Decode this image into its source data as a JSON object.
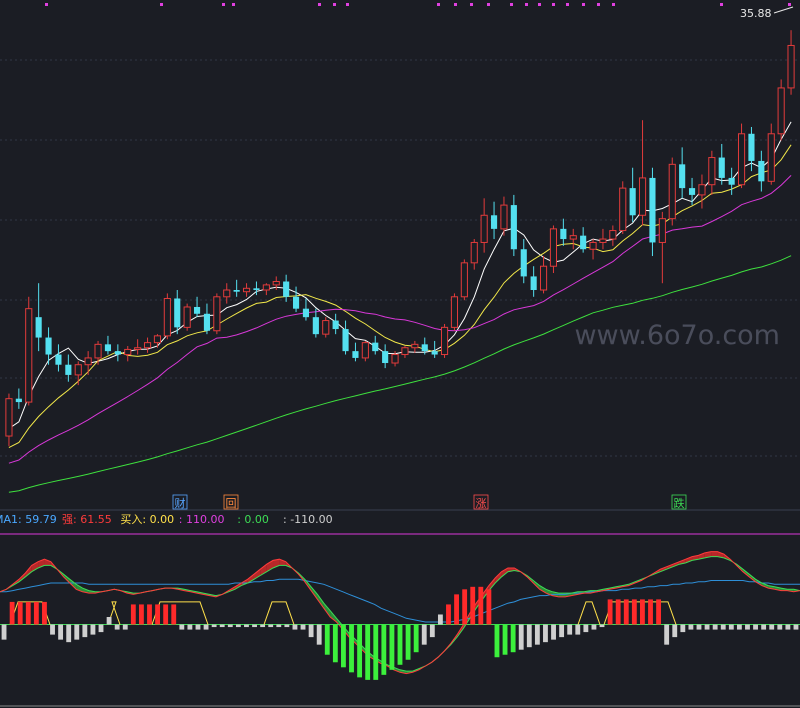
{
  "watermark": "www.6o7o.com",
  "price_top_label": "35.88",
  "markers": [
    {
      "text": "财",
      "color": "#58a6ff"
    },
    {
      "text": "回",
      "color": "#ff8a3d"
    },
    {
      "text": "涨",
      "color": "#ff4d4d"
    },
    {
      "text": "跌",
      "color": "#3ddc55"
    }
  ],
  "indicator_readout": [
    {
      "text": "MA1: 59.79",
      "color": "#4aa8ff"
    },
    {
      "text": "强: 61.55",
      "color": "#ff3b3b"
    },
    {
      "text": "买入: 0.00",
      "color": "#ffe04a"
    },
    {
      "text": ": 110.00",
      "color": "#e040e0"
    },
    {
      "text": ": 0.00",
      "color": "#3ddc55"
    },
    {
      "text": ": -110.00",
      "color": "#cfcfcf"
    }
  ],
  "colors": {
    "background": "#1b1d24",
    "up": "#e23b3b",
    "down": "#54e0f0",
    "ma_fast": "#ffffff",
    "ma_mid": "#f2e84a",
    "ma_slow": "#d838d8",
    "ma_long": "#3ee03e",
    "grid": "#323646"
  },
  "chart_data": [
    {
      "type": "candlestick",
      "ylim": [
        10,
        36.5
      ],
      "candles": [
        [
          12.0,
          14.5,
          11.4,
          14.2
        ],
        [
          14.2,
          14.8,
          13.6,
          14.0
        ],
        [
          14.0,
          20.2,
          13.8,
          19.5
        ],
        [
          19.0,
          21.0,
          17.0,
          17.8
        ],
        [
          17.8,
          18.4,
          16.2,
          16.8
        ],
        [
          16.8,
          17.4,
          15.8,
          16.2
        ],
        [
          16.2,
          16.8,
          15.2,
          15.6
        ],
        [
          15.6,
          16.4,
          15.0,
          16.2
        ],
        [
          16.2,
          17.0,
          15.6,
          16.6
        ],
        [
          16.6,
          17.6,
          16.2,
          17.4
        ],
        [
          17.4,
          17.9,
          16.8,
          17.0
        ],
        [
          17.0,
          17.4,
          16.4,
          16.8
        ],
        [
          16.8,
          17.3,
          16.4,
          17.1
        ],
        [
          17.1,
          17.7,
          16.8,
          17.2
        ],
        [
          17.2,
          17.8,
          16.9,
          17.5
        ],
        [
          17.5,
          18.0,
          17.2,
          17.9
        ],
        [
          17.9,
          20.4,
          17.7,
          20.1
        ],
        [
          20.1,
          20.6,
          18.0,
          18.4
        ],
        [
          18.4,
          19.8,
          18.2,
          19.6
        ],
        [
          19.6,
          20.2,
          19.0,
          19.2
        ],
        [
          19.2,
          19.8,
          18.0,
          18.2
        ],
        [
          18.2,
          20.4,
          18.0,
          20.2
        ],
        [
          20.2,
          21.0,
          19.8,
          20.6
        ],
        [
          20.6,
          21.2,
          20.2,
          20.5
        ],
        [
          20.5,
          21.0,
          20.2,
          20.7
        ],
        [
          20.7,
          21.1,
          20.3,
          20.6
        ],
        [
          20.6,
          21.0,
          20.3,
          20.9
        ],
        [
          20.9,
          21.4,
          20.6,
          21.1
        ],
        [
          21.1,
          21.5,
          19.9,
          20.2
        ],
        [
          20.2,
          20.8,
          19.3,
          19.5
        ],
        [
          19.5,
          20.1,
          18.8,
          19.0
        ],
        [
          19.0,
          19.5,
          17.8,
          18.0
        ],
        [
          18.0,
          19.0,
          17.8,
          18.8
        ],
        [
          18.8,
          19.2,
          18.0,
          18.3
        ],
        [
          18.3,
          18.8,
          16.8,
          17.0
        ],
        [
          17.0,
          17.5,
          16.4,
          16.6
        ],
        [
          16.6,
          17.6,
          16.4,
          17.5
        ],
        [
          17.5,
          17.9,
          16.8,
          17.0
        ],
        [
          17.0,
          17.4,
          16.0,
          16.3
        ],
        [
          16.3,
          17.0,
          16.1,
          16.8
        ],
        [
          16.8,
          17.3,
          16.6,
          17.2
        ],
        [
          17.2,
          17.6,
          16.9,
          17.4
        ],
        [
          17.4,
          17.8,
          16.8,
          17.0
        ],
        [
          17.0,
          17.6,
          16.6,
          16.8
        ],
        [
          16.8,
          18.6,
          16.6,
          18.4
        ],
        [
          18.4,
          20.4,
          18.2,
          20.2
        ],
        [
          20.2,
          22.4,
          20.0,
          22.2
        ],
        [
          22.2,
          23.6,
          21.8,
          23.4
        ],
        [
          23.4,
          26.0,
          22.8,
          25.0
        ],
        [
          25.0,
          25.8,
          23.6,
          24.2
        ],
        [
          24.2,
          26.1,
          23.8,
          25.6
        ],
        [
          25.6,
          26.2,
          22.6,
          23.0
        ],
        [
          23.0,
          23.6,
          21.0,
          21.4
        ],
        [
          21.4,
          22.0,
          20.2,
          20.6
        ],
        [
          20.6,
          22.6,
          20.4,
          22.0
        ],
        [
          22.0,
          24.4,
          21.6,
          24.2
        ],
        [
          24.2,
          24.8,
          23.2,
          23.6
        ],
        [
          23.6,
          24.2,
          23.0,
          23.8
        ],
        [
          23.8,
          24.3,
          22.8,
          23.0
        ],
        [
          23.0,
          23.6,
          22.4,
          23.4
        ],
        [
          23.4,
          24.2,
          23.0,
          23.6
        ],
        [
          23.6,
          24.4,
          23.2,
          24.1
        ],
        [
          24.1,
          27.0,
          23.9,
          26.6
        ],
        [
          26.6,
          27.8,
          24.6,
          25.0
        ],
        [
          25.0,
          30.6,
          24.4,
          27.2
        ],
        [
          27.2,
          27.8,
          22.6,
          23.4
        ],
        [
          23.4,
          25.2,
          21.0,
          24.8
        ],
        [
          24.8,
          28.4,
          24.4,
          28.0
        ],
        [
          28.0,
          29.0,
          26.0,
          26.6
        ],
        [
          26.6,
          27.2,
          25.6,
          26.2
        ],
        [
          26.2,
          27.4,
          25.4,
          26.8
        ],
        [
          26.8,
          28.8,
          26.2,
          28.4
        ],
        [
          28.4,
          29.2,
          26.8,
          27.2
        ],
        [
          27.2,
          27.8,
          26.2,
          26.8
        ],
        [
          26.8,
          30.4,
          26.6,
          29.8
        ],
        [
          29.8,
          30.2,
          27.6,
          28.2
        ],
        [
          28.2,
          28.8,
          26.4,
          27.0
        ],
        [
          27.0,
          30.4,
          26.8,
          29.8
        ],
        [
          29.8,
          33.0,
          29.4,
          32.5
        ],
        [
          32.5,
          35.9,
          32.1,
          35.0
        ]
      ],
      "ma_periods": [
        5,
        10,
        20,
        60
      ]
    },
    {
      "type": "line+bar",
      "series": [
        {
          "values": [
            26,
            28,
            32,
            36,
            41,
            47,
            50,
            52,
            50,
            44,
            38,
            33,
            28,
            26,
            25,
            25,
            26,
            27,
            28,
            27,
            25,
            24,
            25,
            26,
            27,
            28,
            29,
            29,
            28,
            27,
            26,
            25,
            24,
            23,
            22,
            24,
            27,
            30,
            33,
            36,
            40,
            44,
            48,
            51,
            52,
            50,
            45,
            40,
            34,
            27,
            20,
            13,
            6,
            2,
            -4,
            -10,
            -15,
            -20,
            -25,
            -28,
            -31,
            -33,
            -36,
            -38,
            -39,
            -38,
            -36,
            -33,
            -30,
            -26,
            -21,
            -15,
            -8,
            0,
            9,
            17,
            24,
            31,
            37,
            42,
            45,
            45,
            42,
            38,
            33,
            28,
            25,
            23,
            22,
            22,
            23,
            24,
            25,
            25,
            26,
            27,
            28,
            29,
            30,
            31,
            33,
            35,
            38,
            41,
            44,
            46,
            48,
            50,
            52,
            54,
            55,
            57,
            58,
            58,
            56,
            52,
            47,
            42,
            38,
            34,
            31,
            29,
            28,
            27,
            27,
            26,
            27
          ]
        },
        {
          "values": [
            26,
            28,
            31,
            34,
            38,
            42,
            45,
            47,
            47,
            44,
            40,
            36,
            32,
            29,
            27,
            26,
            26,
            27,
            28,
            27,
            26,
            25,
            25,
            26,
            27,
            28,
            29,
            29,
            29,
            28,
            27,
            26,
            25,
            24,
            23,
            24,
            26,
            28,
            31,
            33,
            36,
            39,
            42,
            45,
            47,
            47,
            45,
            41,
            36,
            30,
            24,
            17,
            11,
            5,
            -1,
            -7,
            -12,
            -17,
            -22,
            -26,
            -29,
            -32,
            -34,
            -36,
            -37,
            -37,
            -35,
            -33,
            -30,
            -26,
            -21,
            -16,
            -10,
            -3,
            5,
            13,
            20,
            27,
            33,
            38,
            42,
            43,
            42,
            39,
            35,
            31,
            28,
            26,
            25,
            25,
            25,
            26,
            26,
            27,
            27,
            28,
            29,
            30,
            31,
            32,
            34,
            36,
            38,
            40,
            42,
            44,
            46,
            48,
            49,
            51,
            52,
            53,
            54,
            54,
            53,
            51,
            48,
            44,
            40,
            36,
            33,
            31,
            30,
            29,
            28,
            28,
            27
          ]
        },
        {
          "values": [
            26,
            26,
            27,
            28,
            29,
            30,
            31,
            32,
            33,
            33,
            33,
            33,
            33,
            33,
            32,
            32,
            32,
            32,
            32,
            32,
            32,
            32,
            32,
            32,
            32,
            32,
            32,
            32,
            32,
            32,
            32,
            32,
            32,
            32,
            32,
            32,
            32,
            33,
            33,
            33,
            34,
            34,
            35,
            35,
            36,
            36,
            36,
            36,
            35,
            34,
            33,
            32,
            30,
            28,
            26,
            24,
            22,
            20,
            18,
            16,
            13,
            11,
            9,
            7,
            5,
            4,
            3,
            2,
            2,
            2,
            2,
            2,
            3,
            4,
            5,
            7,
            9,
            11,
            13,
            15,
            17,
            18,
            20,
            21,
            22,
            23,
            23,
            24,
            24,
            24,
            25,
            25,
            25,
            26,
            26,
            27,
            27,
            27,
            28,
            28,
            29,
            29,
            30,
            30,
            31,
            31,
            32,
            32,
            33,
            33,
            34,
            34,
            35,
            35,
            35,
            35,
            35,
            35,
            34,
            34,
            33,
            33,
            32,
            32,
            32,
            32,
            32,
            31,
            31
          ]
        },
        {
          "values": [
            -12,
            18,
            18,
            18,
            18,
            18,
            -8,
            -12,
            -14,
            -12,
            -10,
            -8,
            -6,
            6,
            -4,
            -4,
            16,
            16,
            16,
            16,
            16,
            16,
            -4,
            -4,
            -4,
            -4,
            -2,
            -2,
            -2,
            -2,
            -2,
            -2,
            -2,
            -2,
            -2,
            -2,
            -4,
            -4,
            -10,
            -16,
            -24,
            -30,
            -34,
            -38,
            -42,
            -44,
            -44,
            -40,
            -36,
            -32,
            -28,
            -22,
            -16,
            -10,
            8,
            16,
            24,
            28,
            30,
            30,
            28,
            -26,
            -24,
            -22,
            -20,
            -18,
            -16,
            -14,
            -12,
            -10,
            -8,
            -8,
            -6,
            -4,
            -2,
            20,
            20,
            20,
            20,
            20,
            20,
            20,
            -16,
            -10,
            -6,
            -4,
            -4,
            -4,
            -4,
            -4,
            -4,
            -4,
            -4,
            -4,
            -4,
            -4,
            -4,
            -4,
            -4
          ]
        }
      ],
      "ylim": [
        -60,
        72
      ],
      "buy_signal_levels": [
        0,
        110
      ],
      "reference_lines": [
        110,
        0,
        -110
      ]
    }
  ]
}
